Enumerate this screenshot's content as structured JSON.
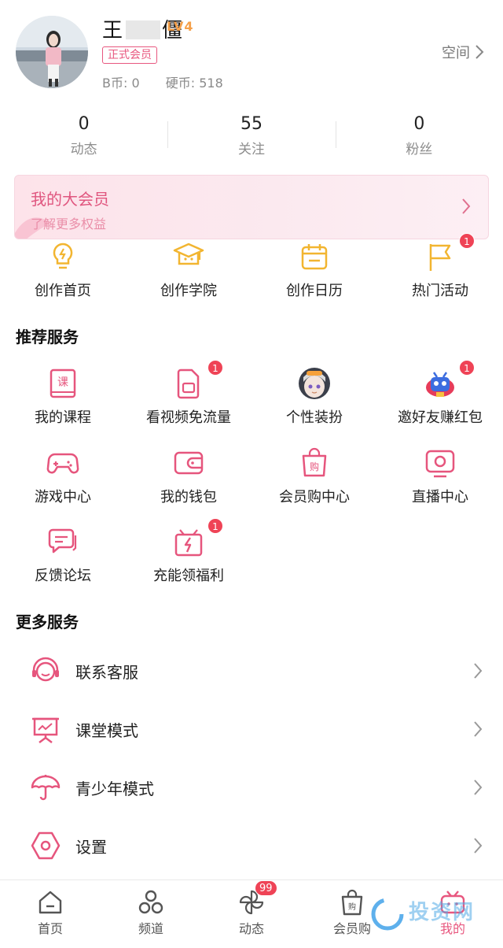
{
  "profile": {
    "username_visible_start": "王",
    "username_visible_end": "僵",
    "level": "LV4",
    "member_badge": "正式会员",
    "b_coins": "B币: 0",
    "coins": "硬币: 518",
    "space_link": "空间"
  },
  "stats": [
    {
      "value": "0",
      "label": "动态"
    },
    {
      "value": "55",
      "label": "关注"
    },
    {
      "value": "0",
      "label": "粉丝"
    }
  ],
  "vip": {
    "title": "我的大会员",
    "subtitle": "了解更多权益"
  },
  "creator": [
    {
      "label": "创作首页",
      "icon": "lightbulb-icon"
    },
    {
      "label": "创作学院",
      "icon": "graduation-cap-icon"
    },
    {
      "label": "创作日历",
      "icon": "calendar-icon"
    },
    {
      "label": "热门活动",
      "icon": "flag-icon",
      "badge": "1"
    }
  ],
  "recommended": {
    "title": "推荐服务",
    "items": [
      {
        "label": "我的课程",
        "icon": "course-book-icon"
      },
      {
        "label": "看视频免流量",
        "icon": "sim-card-icon",
        "badge": "1"
      },
      {
        "label": "个性装扮",
        "icon": "anime-avatar-icon"
      },
      {
        "label": "邀好友赚红包",
        "icon": "invite-mascot-icon",
        "badge": "1"
      },
      {
        "label": "游戏中心",
        "icon": "gamepad-icon"
      },
      {
        "label": "我的钱包",
        "icon": "wallet-icon"
      },
      {
        "label": "会员购中心",
        "icon": "shopping-bag-icon"
      },
      {
        "label": "直播中心",
        "icon": "live-tv-icon"
      },
      {
        "label": "反馈论坛",
        "icon": "chat-bubbles-icon"
      },
      {
        "label": "充能领福利",
        "icon": "gift-lightning-icon",
        "badge": "1"
      }
    ]
  },
  "more": {
    "title": "更多服务",
    "items": [
      {
        "label": "联系客服",
        "icon": "headset-icon"
      },
      {
        "label": "课堂模式",
        "icon": "classroom-board-icon"
      },
      {
        "label": "青少年模式",
        "icon": "umbrella-icon"
      },
      {
        "label": "设置",
        "icon": "settings-hexagon-icon"
      }
    ]
  },
  "tabbar": [
    {
      "label": "首页",
      "icon": "home-icon"
    },
    {
      "label": "频道",
      "icon": "channel-circles-icon"
    },
    {
      "label": "动态",
      "icon": "pinwheel-icon",
      "badge": "99"
    },
    {
      "label": "会员购",
      "icon": "shopping-bag-icon"
    },
    {
      "label": "我的",
      "icon": "tv-mine-icon",
      "active": true
    }
  ],
  "watermark": "投资网",
  "colors": {
    "accent": "#e8577f",
    "badge": "#ef4356",
    "creator_icon": "#f2b530",
    "level": "#f5a04a"
  }
}
